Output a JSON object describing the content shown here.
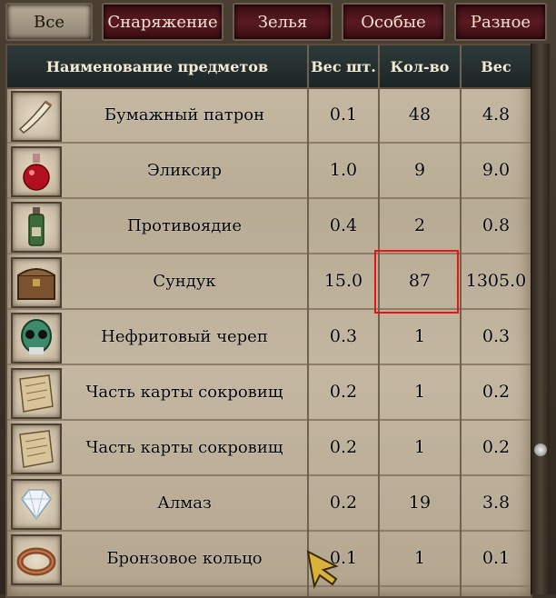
{
  "tabs": [
    {
      "label": "Все",
      "active": true
    },
    {
      "label": "Снаряжение",
      "active": false
    },
    {
      "label": "Зелья",
      "active": false
    },
    {
      "label": "Особые",
      "active": false
    },
    {
      "label": "Разное",
      "active": false
    }
  ],
  "header": {
    "name": "Наименование предметов",
    "unit_weight": "Вес шт.",
    "qty": "Кол-во",
    "weight": "Вес"
  },
  "items": [
    {
      "icon": "paper-cartridge-icon",
      "name": "Бумажный патрон",
      "unit_weight": "0.1",
      "qty": "48",
      "weight": "4.8"
    },
    {
      "icon": "elixir-flask-icon",
      "name": "Эликсир",
      "unit_weight": "1.0",
      "qty": "9",
      "weight": "9.0"
    },
    {
      "icon": "antidote-bottle-icon",
      "name": "Противоядие",
      "unit_weight": "0.4",
      "qty": "2",
      "weight": "0.8"
    },
    {
      "icon": "chest-icon",
      "name": "Сундук",
      "unit_weight": "15.0",
      "qty": "87",
      "weight": "1305.0"
    },
    {
      "icon": "jade-skull-icon",
      "name": "Нефритовый череп",
      "unit_weight": "0.3",
      "qty": "1",
      "weight": "0.3"
    },
    {
      "icon": "map-piece-icon",
      "name": "Часть карты сокровищ",
      "unit_weight": "0.2",
      "qty": "1",
      "weight": "0.2"
    },
    {
      "icon": "map-piece-icon",
      "name": "Часть карты сокровищ",
      "unit_weight": "0.2",
      "qty": "1",
      "weight": "0.2"
    },
    {
      "icon": "diamond-icon",
      "name": "Алмаз",
      "unit_weight": "0.2",
      "qty": "19",
      "weight": "3.8"
    },
    {
      "icon": "bronze-ring-icon",
      "name": "Бронзовое кольцо",
      "unit_weight": "0.1",
      "qty": "1",
      "weight": "0.1"
    }
  ],
  "colors": {
    "highlight": "#e11111",
    "tab_active": "#b9ad99",
    "tab_inactive": "#5a1a22"
  }
}
